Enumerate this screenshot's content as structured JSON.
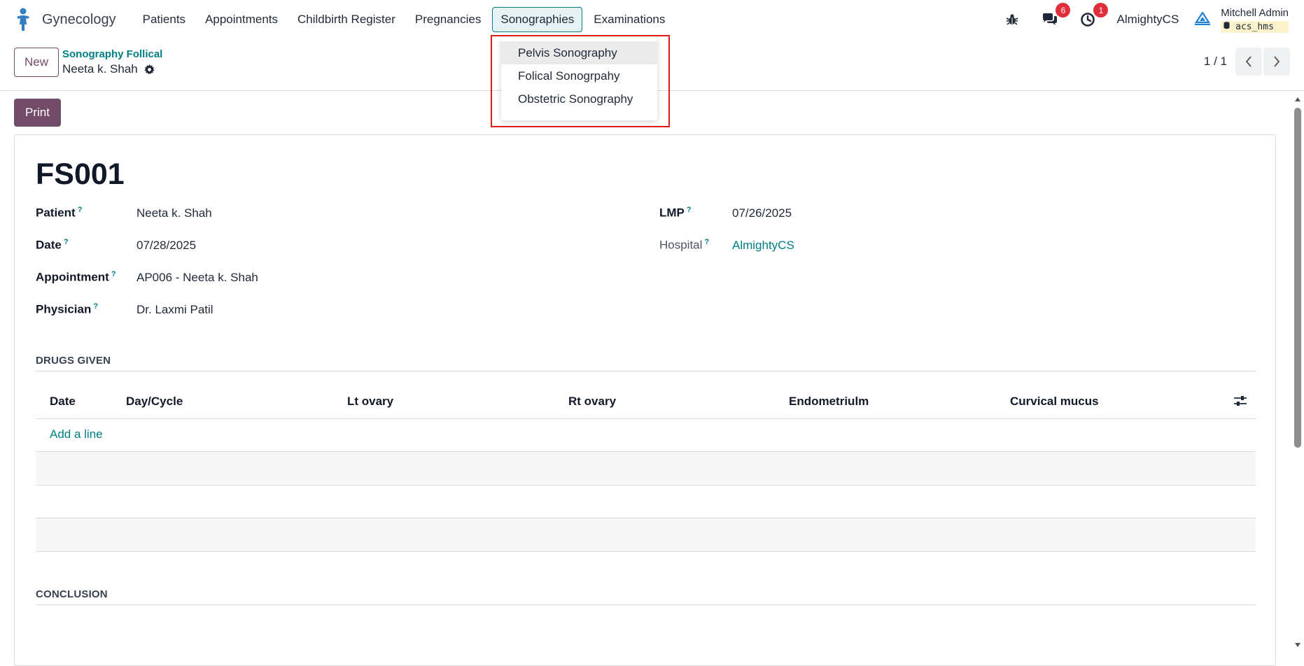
{
  "topbar": {
    "app_name": "Gynecology",
    "menu": [
      {
        "label": "Patients"
      },
      {
        "label": "Appointments"
      },
      {
        "label": "Childbirth Register"
      },
      {
        "label": "Pregnancies"
      },
      {
        "label": "Sonographies"
      },
      {
        "label": "Examinations"
      }
    ],
    "messages_count": "6",
    "activities_count": "1",
    "company": "AlmightyCS",
    "user_name": "Mitchell Admin",
    "database": "acs_hms"
  },
  "control": {
    "new_label": "New",
    "breadcrumb": "Sonography Follical",
    "record_name": "Neeta k. Shah",
    "pager": "1 / 1"
  },
  "actions": {
    "print_label": "Print"
  },
  "sonography_menu": {
    "items": [
      {
        "label": "Pelvis Sonography"
      },
      {
        "label": "Folical Sonogrpahy"
      },
      {
        "label": "Obstetric Sonography"
      }
    ]
  },
  "form": {
    "title": "FS001",
    "help_marker": "?",
    "patient_label": "Patient",
    "patient_value": "Neeta k. Shah",
    "date_label": "Date",
    "date_value": "07/28/2025",
    "appointment_label": "Appointment",
    "appointment_value": "AP006 - Neeta k. Shah",
    "physician_label": "Physician",
    "physician_value": "Dr. Laxmi Patil",
    "lmp_label": "LMP",
    "lmp_value": "07/26/2025",
    "hospital_label": "Hospital",
    "hospital_value": "AlmightyCS",
    "drugs_section": "DRUGS GIVEN",
    "columns": [
      "Date",
      "Day/Cycle",
      "Lt ovary",
      "Rt ovary",
      "Endometriulm",
      "Curvical mucus"
    ],
    "add_line": "Add a line",
    "conclusion_section": "CONCLUSION"
  },
  "colors": {
    "brand": "#714b67",
    "link": "#017e84",
    "highlight": "#e01b1b"
  }
}
